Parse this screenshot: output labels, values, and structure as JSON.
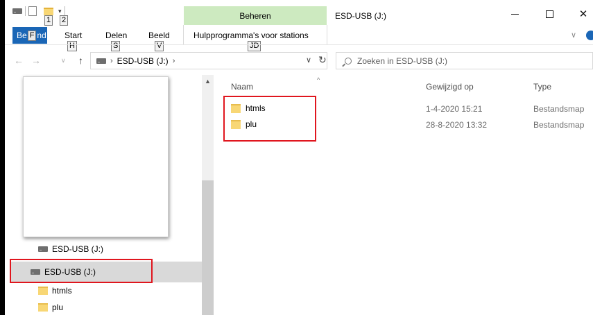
{
  "window": {
    "title": "ESD-USB (J:)",
    "manage_tab": "Beheren",
    "tool_tab": "Hulpprogramma's voor stations",
    "tool_tab_keytip": "JD",
    "close_symbol": "✕"
  },
  "quick_access": {
    "keytip_1": "1",
    "keytip_2": "2",
    "customize_symbol": "▾"
  },
  "ribbon": {
    "file_prefix": "Be",
    "file_keytip": "F",
    "file_suffix": "nd",
    "tabs": [
      {
        "label": "Start",
        "keytip": "H"
      },
      {
        "label": "Delen",
        "keytip": "S"
      },
      {
        "label": "Beeld",
        "keytip": "V"
      }
    ],
    "expand_symbol": "∨"
  },
  "navigation": {
    "back": "←",
    "forward": "→",
    "recent": "∨",
    "up": "↑",
    "path_separator": "›",
    "path": "ESD-USB (J:)",
    "path_trailing": "›",
    "dropdown": "∨",
    "refresh": "↻"
  },
  "search": {
    "placeholder": "Zoeken in ESD-USB (J:)"
  },
  "nav_pane": {
    "items": [
      {
        "label": "ESD-USB (J:)",
        "icon": "drive-icon"
      },
      {
        "label": "ESD-USB (J:)",
        "icon": "drive-icon",
        "selected": true
      },
      {
        "label": "htmls",
        "icon": "folder-icon"
      },
      {
        "label": "plu",
        "icon": "folder-icon"
      }
    ],
    "scroll_up": "▲"
  },
  "file_list": {
    "columns": [
      "Naam",
      "Gewijzigd op",
      "Type"
    ],
    "sort_indicator": "^",
    "rows": [
      {
        "name": "htmls",
        "modified": "1-4-2020 15:21",
        "type": "Bestandsmap"
      },
      {
        "name": "plu",
        "modified": "28-8-2020 13:32",
        "type": "Bestandsmap"
      }
    ]
  },
  "colors": {
    "accent": "#1a66b6",
    "manage_tab_bg": "#cdeac0",
    "highlight_red": "#e0161e",
    "selected_bg": "#d9d9d9"
  }
}
